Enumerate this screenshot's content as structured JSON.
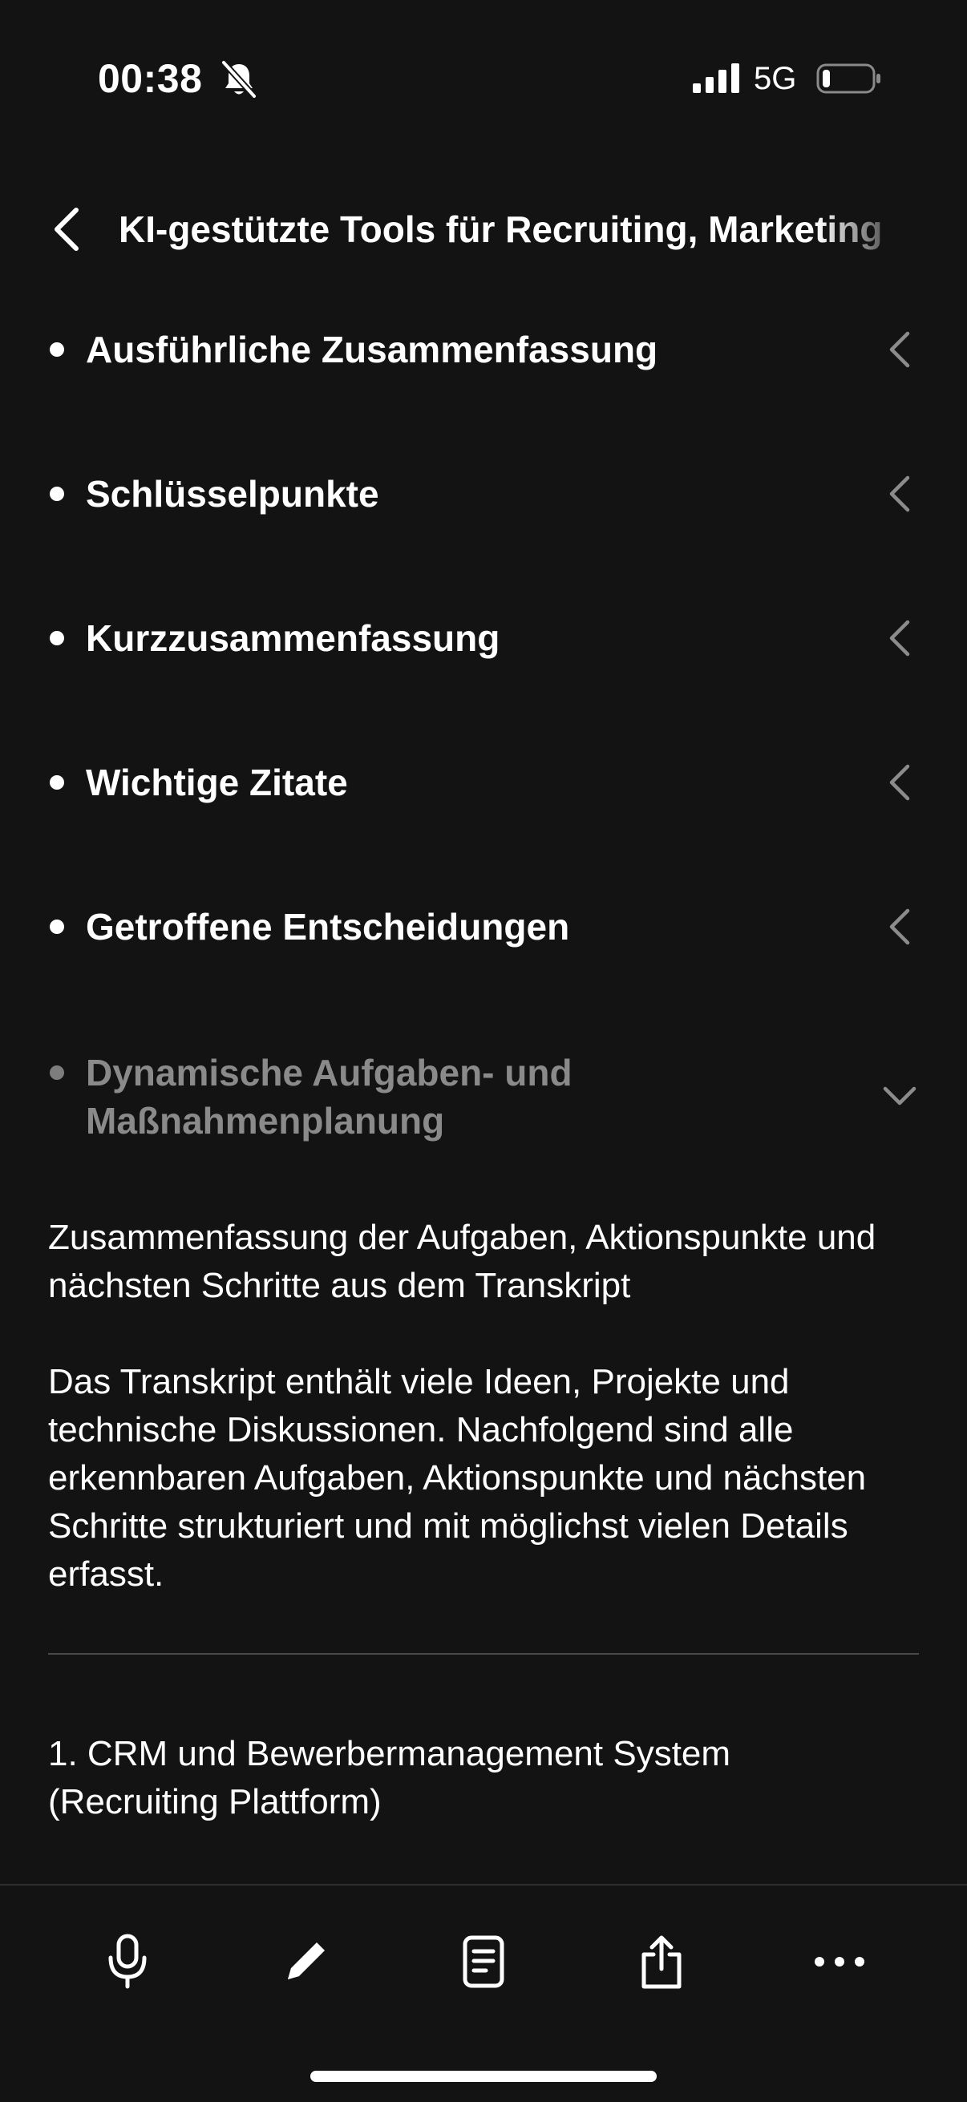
{
  "status_bar": {
    "time": "00:38",
    "network": "5G",
    "icons": [
      "bell-slash-icon",
      "cellular-signal-icon",
      "battery-low-icon"
    ]
  },
  "header": {
    "title": "KI-gestützte Tools für Recruiting, Marketing",
    "back_icon": "chevron-left-icon"
  },
  "sections": [
    {
      "label": "Ausführliche Zusammenfassung",
      "state": "collapsed"
    },
    {
      "label": "Schlüsselpunkte",
      "state": "collapsed"
    },
    {
      "label": "Kurzzusammenfassung",
      "state": "collapsed"
    },
    {
      "label": "Wichtige Zitate",
      "state": "collapsed"
    },
    {
      "label": "Getroffene Entscheidungen",
      "state": "collapsed"
    },
    {
      "label": "Dynamische Aufgaben- und Maßnahmenplanung",
      "state": "expanded"
    }
  ],
  "content": {
    "intro": "Zusammenfassung der Aufgaben, Aktionspunkte und nächsten Schritte aus dem Transkript",
    "description": "Das Transkript enthält viele Ideen, Projekte und technische Diskussionen. Nachfolgend sind alle erkennbaren Aufgaben, Aktionspunkte und nächsten Schritte strukturiert und mit möglichst vielen Details erfasst.",
    "first_heading": "1. CRM und Bewerbermanagement System (Recruiting Plattform)"
  },
  "toolbar": {
    "icons": [
      "microphone-icon",
      "pencil-icon",
      "document-icon",
      "share-icon",
      "more-icon"
    ]
  },
  "colors": {
    "background": "#131313",
    "text": "#ffffff",
    "muted_text": "#8a8a8a",
    "chevron": "#8c8c8c"
  }
}
